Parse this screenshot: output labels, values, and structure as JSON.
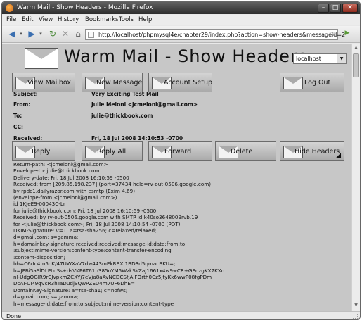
{
  "window": {
    "title": "Warm Mail - Show Headers - Mozilla Firefox",
    "min_glyph": "–",
    "max_glyph": "□",
    "close_glyph": "✕"
  },
  "menu": [
    "File",
    "Edit",
    "View",
    "History",
    "Bookmarks",
    "Tools",
    "Help"
  ],
  "nav": {
    "back_glyph": "◀",
    "forward_glyph": "▶",
    "reload_glyph": "↻",
    "stop_glyph": "✕",
    "home_glyph": "⌂",
    "url": "http://localhost/phpmysql4e/chapter29/index.php?action=show-headers&messageid=2",
    "bookmark_glyph": "☆",
    "go_glyph": "▶"
  },
  "app": {
    "title": "Warm Mail - Show Headers",
    "host_select": "localhost",
    "select_arrow": "▼"
  },
  "top_buttons": [
    "View Mailbox",
    "New Message",
    "Account Setup",
    "Log Out"
  ],
  "message": {
    "labels": {
      "subject": "Subject:",
      "from": "From:",
      "to": "To:",
      "cc": "CC:",
      "received": "Received:"
    },
    "subject": "Very Exciting Test Mail",
    "from": "Julie Meloni <jcmeloni@gmail.com>",
    "to": "julie@thickbook.com",
    "cc": "",
    "received": "Fri, 18 Jul 2008 14:10:53 -0700"
  },
  "action_buttons": [
    "Reply",
    "Reply All",
    "Forward",
    "Delete",
    "Hide Headers"
  ],
  "hide_headers_triangle": "◢",
  "headers": [
    "Return-path: <jcmeloni@gmail.com>",
    "Envelope-to: julie@thickbook.com",
    "Delivery-date: Fri, 18 Jul 2008 16:10:59 -0500",
    "Received: from [209.85.198.237] (port=37434 helo=rv-out-0506.google.com)",
    "by rpdc1.dailyrazor.com with esmtp (Exim 4.69)",
    "(envelope-from <jcmeloni@gmail.com>)",
    "id 1KJeE9-00043C-Lr",
    "for julie@thickbook.com; Fri, 18 Jul 2008 16:10:59 -0500",
    "Received: by rv-out-0506.google.com with SMTP id k40so3648009rvb.19",
    "for <julie@thickbook.com>; Fri, 18 Jul 2008 14:10:54 -0700 (PDT)",
    "DKIM-Signature: v=1; a=rsa-sha256; c=relaxed/relaxed;",
    "d=gmail.com; s=gamma;",
    "h=domainkey-signature:received:received:message-id:date:from:to",
    ":subject:mime-version:content-type:content-transfer-encoding",
    ":content-disposition;",
    "bh=C6rIc4m5oK/47UWXaV7dw443mEkRBXI1BD3d5qmacBKU=;",
    "b=JFBi5aSlDLPLuSs+dsVKP6T61n385oYM5WzkSkZaJ1661x4w9wCR+GEdzgKX7KXo",
    "nl-UdgOGIR9rCJvpkm2CXYj7eVja8aAvNCDCSfjAlFOrth0Cz5jtyKk6wwP08fgPDm",
    "DcAI-UM9qVcR3hTaDudjSQwPZEU4m7UF6DhE=",
    "DomainKey-Signature: a=rsa-sha1; c=nofws;",
    "d=gmail.com; s=gamma;",
    "h=message-id:date:from:to:subject:mime-version:content-type"
  ],
  "status": "Done"
}
